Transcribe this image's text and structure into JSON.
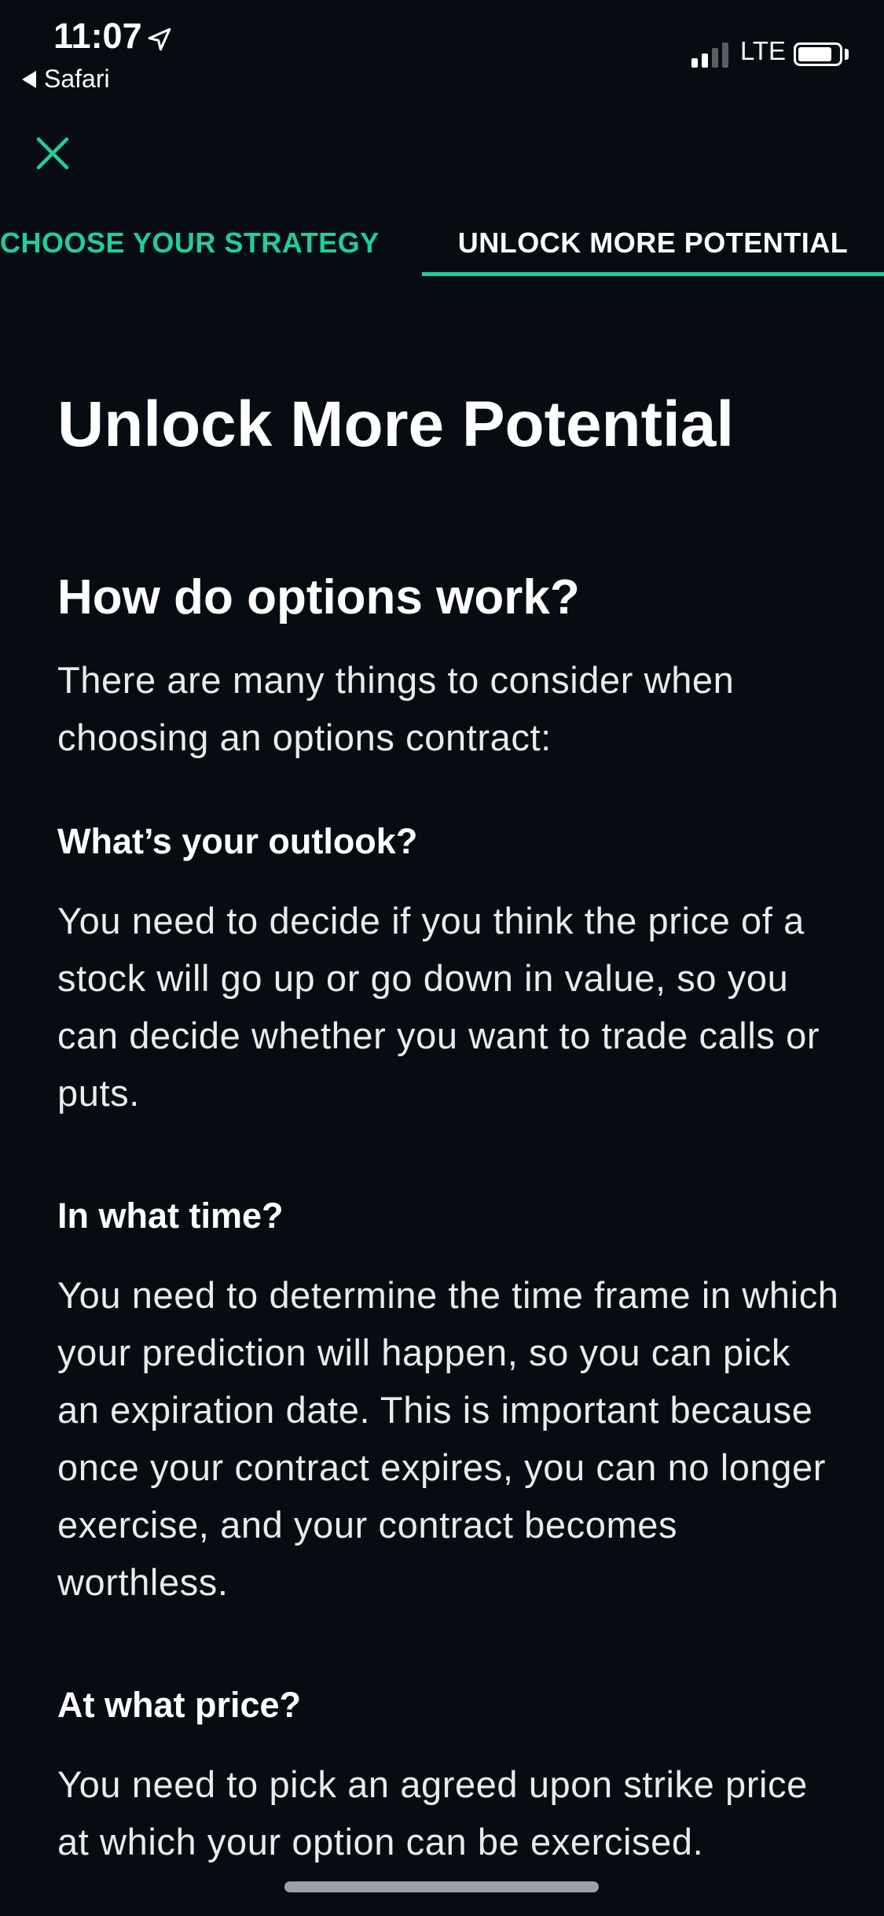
{
  "status_bar": {
    "time": "11:07",
    "back_app": "Safari",
    "network": "LTE"
  },
  "icons": {
    "close": "close-icon",
    "location": "location-arrow-icon",
    "back": "back-arrow-icon",
    "signal": "signal-bars-icon",
    "battery": "battery-icon"
  },
  "tabs": [
    {
      "label": "CHOOSE YOUR STRATEGY",
      "active": false
    },
    {
      "label": "UNLOCK MORE POTENTIAL",
      "active": true
    }
  ],
  "colors": {
    "background": "#060c12",
    "accent": "#21ce99",
    "text": "#ffffff"
  },
  "content": {
    "title": "Unlock More Potential",
    "section_heading": "How do options work?",
    "intro": "There are many things to consider when choosing an options contract:",
    "sections": [
      {
        "heading": "What’s your outlook?",
        "body": "You need to decide if you think the price of a stock will go up or go down in value, so you can decide whether you want to trade calls or puts."
      },
      {
        "heading": "In what time?",
        "body": "You need to determine the time frame in which your prediction will happen, so you can pick an expiration date. This is important because once your contract expires, you can no longer exercise, and your contract becomes worthless."
      },
      {
        "heading": "At what price?",
        "body": "You need to pick an agreed upon strike price at which your option can be exercised."
      }
    ]
  }
}
